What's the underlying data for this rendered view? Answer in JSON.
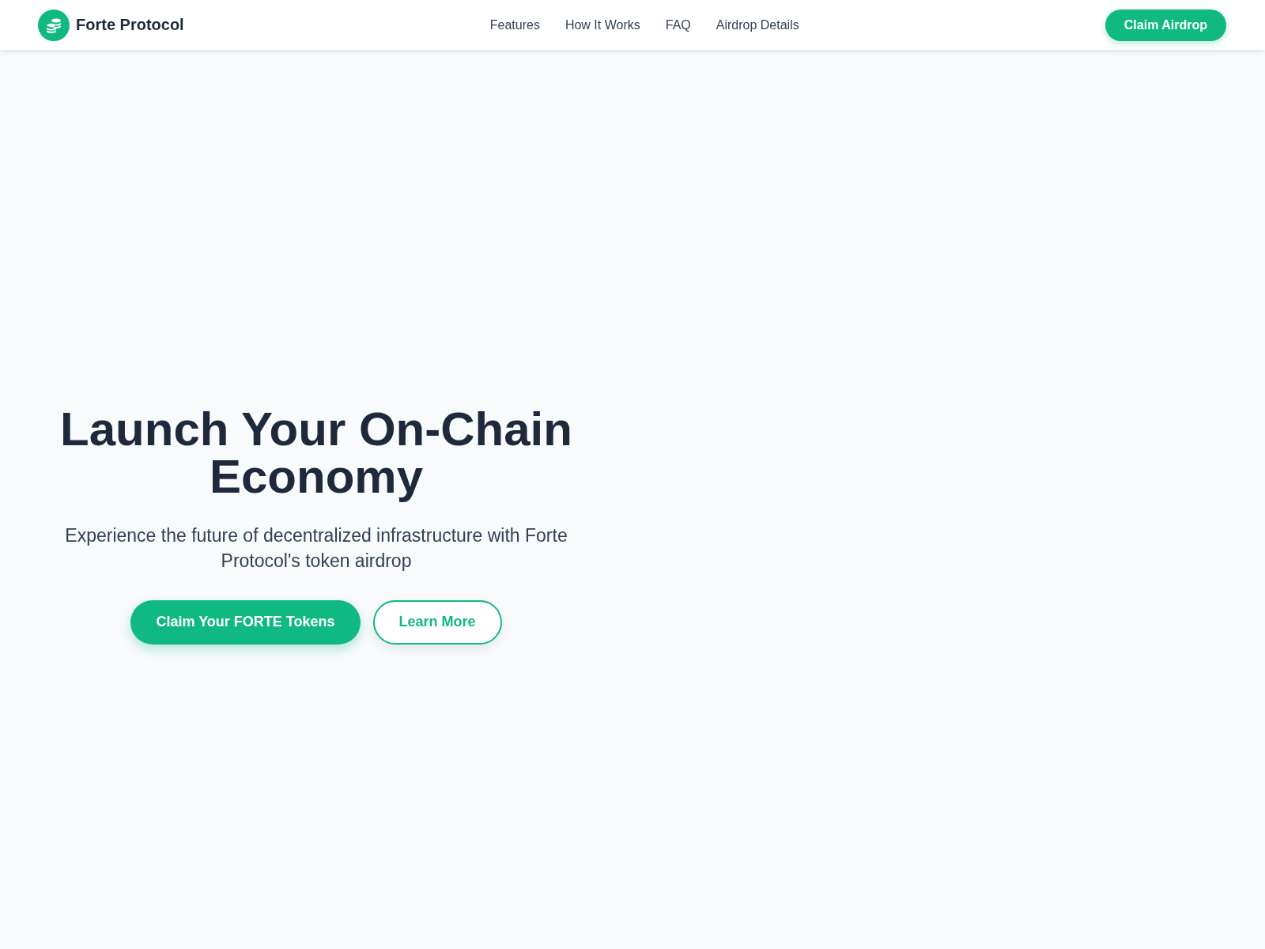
{
  "navbar": {
    "brand": "Forte Protocol",
    "links": [
      {
        "label": "Features"
      },
      {
        "label": "How It Works"
      },
      {
        "label": "FAQ"
      },
      {
        "label": "Airdrop Details"
      }
    ],
    "cta": "Claim Airdrop"
  },
  "hero": {
    "title": "Launch Your On-Chain Economy",
    "subtitle": "Experience the future of decentralized infrastructure with Forte Protocol's token airdrop",
    "buttons": [
      {
        "label": "Claim Your FORTE Tokens",
        "kind": "primary"
      },
      {
        "label": "Learn More",
        "kind": "outline"
      }
    ]
  }
}
